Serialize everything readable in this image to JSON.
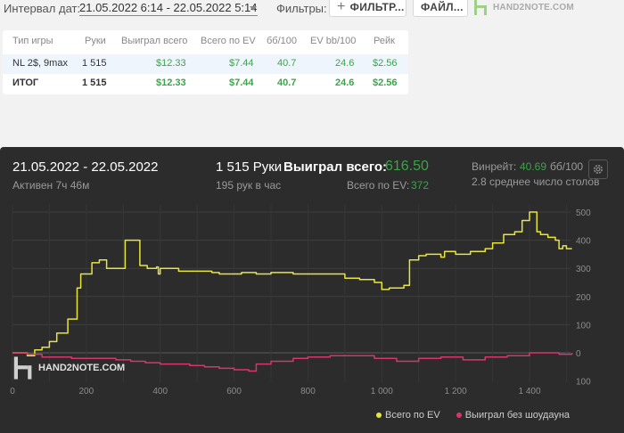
{
  "toolbar": {
    "interval_label": "Интервал дат:",
    "date_range": "21.05.2022 6:14 - 22.05.2022 5:14",
    "filters_label": "Фильтры:",
    "filters_button": "ФИЛЬТР...",
    "files_button": "ФАЙЛ...",
    "brand": "HAND2NOTE.COM"
  },
  "table": {
    "headers": [
      "Тип игры",
      "Руки",
      "Выиграл всего",
      "Всего по EV",
      "бб/100",
      "EV bb/100",
      "Рейк"
    ],
    "rows": [
      [
        "NL 2$, 9max",
        "1 515",
        "$12.33",
        "$7.44",
        "40.7",
        "24.6",
        "$2.56"
      ],
      [
        "ИТОГ",
        "1 515",
        "$12.33",
        "$7.44",
        "40.7",
        "24.6",
        "$2.56"
      ]
    ]
  },
  "summary": {
    "date_range": "21.05.2022 - 22.05.2022",
    "active": "Активен 7ч 46м",
    "hands": "1 515 Руки",
    "hands_per_hour": "195 рук в час",
    "won_label": "Выиграл всего:",
    "won_value": "616.50",
    "ev_label": "Всего по EV:",
    "ev_value": "372",
    "winrate_label": "Винрейт:",
    "winrate_value": "40.69",
    "winrate_unit": "бб/100",
    "tables": "2.8 среднее число столов",
    "watermark": "HAND2NOTE.COM"
  },
  "colors": {
    "positive": "#3aa548",
    "ev_line": "#e8e63a",
    "nonshowdown_line": "#d8356f",
    "panel_bg": "#2c2c2c"
  },
  "chart_data": {
    "type": "line",
    "x_ticks": [
      "0",
      "200",
      "400",
      "600",
      "800",
      "1 000",
      "1 200",
      "1 400"
    ],
    "y_ticks": [
      "500",
      "400",
      "300",
      "200",
      "100",
      "0",
      "100"
    ],
    "xlim": [
      0,
      1530
    ],
    "ylim": [
      -100,
      520
    ],
    "series": [
      {
        "name": "Всего по EV",
        "color": "#e8e63a",
        "x": [
          0,
          40,
          60,
          80,
          100,
          120,
          150,
          175,
          185,
          190,
          215,
          235,
          255,
          275,
          305,
          345,
          365,
          390,
          395,
          400,
          420,
          450,
          500,
          540,
          560,
          600,
          620,
          660,
          700,
          760,
          800,
          850,
          900,
          940,
          980,
          1000,
          1020,
          1060,
          1075,
          1100,
          1120,
          1160,
          1170,
          1200,
          1240,
          1280,
          1300,
          1330,
          1360,
          1380,
          1400,
          1420,
          1430,
          1450,
          1470,
          1480,
          1490,
          1500,
          1515
        ],
        "y": [
          0,
          -10,
          10,
          20,
          40,
          70,
          120,
          230,
          280,
          280,
          320,
          330,
          300,
          300,
          400,
          310,
          300,
          305,
          280,
          300,
          300,
          290,
          290,
          285,
          280,
          280,
          285,
          280,
          285,
          280,
          280,
          280,
          265,
          260,
          250,
          225,
          230,
          240,
          330,
          345,
          350,
          340,
          360,
          350,
          360,
          370,
          390,
          420,
          430,
          470,
          500,
          430,
          420,
          410,
          400,
          370,
          380,
          370,
          370
        ]
      },
      {
        "name": "Выиграл без шоудауна",
        "color": "#d8356f",
        "x": [
          0,
          40,
          80,
          120,
          160,
          200,
          240,
          280,
          320,
          360,
          400,
          440,
          480,
          520,
          560,
          600,
          640,
          660,
          700,
          760,
          800,
          860,
          920,
          980,
          1040,
          1100,
          1160,
          1220,
          1280,
          1340,
          1400,
          1440,
          1480,
          1515
        ],
        "y": [
          0,
          -5,
          -15,
          -15,
          -20,
          -20,
          -20,
          -25,
          -30,
          -35,
          -40,
          -40,
          -45,
          -50,
          -55,
          -60,
          -65,
          -40,
          -30,
          -20,
          -15,
          -10,
          -10,
          -20,
          -30,
          -20,
          -15,
          -25,
          -15,
          -10,
          0,
          0,
          -5,
          0
        ]
      }
    ]
  }
}
